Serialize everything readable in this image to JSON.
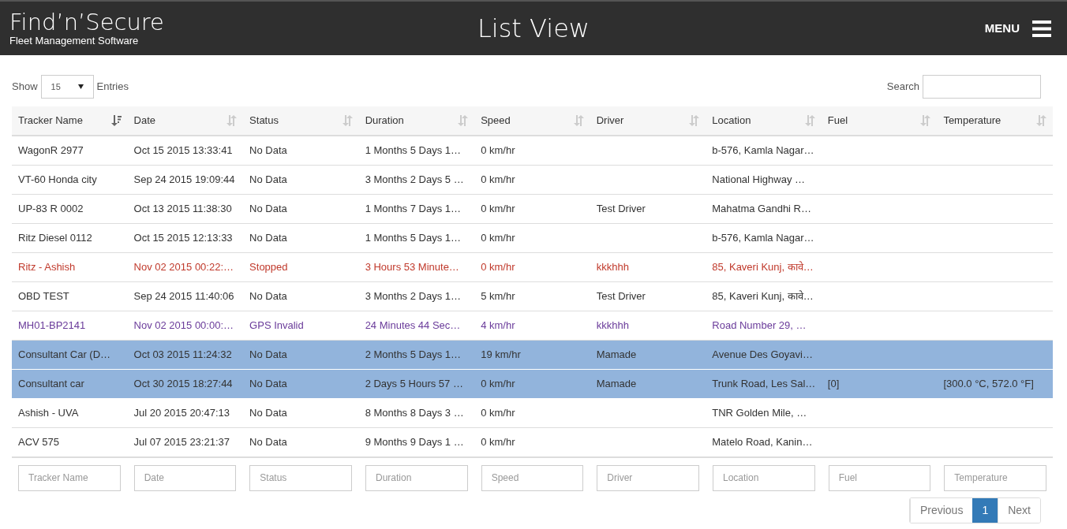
{
  "header": {
    "logo": "Find’n’Secure",
    "tagline": "Fleet Management Software",
    "title": "List View",
    "menu": "MENU"
  },
  "length": {
    "show": "Show",
    "value": "15",
    "entries": "Entries"
  },
  "search": {
    "label": "Search"
  },
  "table": {
    "columns": [
      {
        "label": "Tracker Name",
        "sorted": true
      },
      {
        "label": "Date",
        "sorted": false
      },
      {
        "label": "Status",
        "sorted": false
      },
      {
        "label": "Duration",
        "sorted": false
      },
      {
        "label": "Speed",
        "sorted": false
      },
      {
        "label": "Driver",
        "sorted": false
      },
      {
        "label": "Location",
        "sorted": false
      },
      {
        "label": "Fuel",
        "sorted": false
      },
      {
        "label": "Temperature",
        "sorted": false
      }
    ],
    "rows": [
      {
        "kind": "normal",
        "selected": false,
        "cells": [
          "WagonR 2977",
          "Oct 15 2015 13:33:41",
          "No Data",
          "1 Months 5 Days 1…",
          "0 km/hr",
          "",
          "b-576, Kamla Nagar…",
          "",
          ""
        ]
      },
      {
        "kind": "normal",
        "selected": false,
        "cells": [
          "VT-60 Honda city",
          "Sep 24 2015 19:09:44",
          "No Data",
          "3 Months 2 Days 5 …",
          "0 km/hr",
          "",
          "National Highway …",
          "",
          ""
        ]
      },
      {
        "kind": "normal",
        "selected": false,
        "cells": [
          "UP-83 R 0002",
          "Oct 13 2015 11:38:30",
          "No Data",
          "1 Months 7 Days 1…",
          "0 km/hr",
          "Test Driver",
          "Mahatma Gandhi R…",
          "",
          ""
        ]
      },
      {
        "kind": "normal",
        "selected": false,
        "cells": [
          "Ritz Diesel 0112",
          "Oct 15 2015 12:13:33",
          "No Data",
          "1 Months 5 Days 1…",
          "0 km/hr",
          "",
          "b-576, Kamla Nagar…",
          "",
          ""
        ]
      },
      {
        "kind": "stopped",
        "selected": false,
        "cells": [
          "Ritz - Ashish",
          "Nov 02 2015 00:22:…",
          "Stopped",
          "3 Hours 53 Minute…",
          "0 km/hr",
          "kkkhhh",
          "85, Kaveri Kunj, कावे…",
          "",
          ""
        ]
      },
      {
        "kind": "normal",
        "selected": false,
        "cells": [
          "OBD TEST",
          "Sep 24 2015 11:40:06",
          "No Data",
          "3 Months 2 Days 1…",
          "5 km/hr",
          "Test Driver",
          "85, Kaveri Kunj, कावे…",
          "",
          ""
        ]
      },
      {
        "kind": "gps-invalid",
        "selected": false,
        "cells": [
          "MH01-BP2141",
          "Nov 02 2015 00:00:…",
          "GPS Invalid",
          "24 Minutes 44 Sec…",
          "4 km/hr",
          "kkkhhh",
          "Road Number 29, …",
          "",
          ""
        ]
      },
      {
        "kind": "normal",
        "selected": true,
        "cells": [
          "Consultant Car (D…",
          "Oct 03 2015 11:24:32",
          "No Data",
          "2 Months 5 Days 1…",
          "19 km/hr",
          "Mamade",
          "Avenue Des Goyavi…",
          "",
          ""
        ]
      },
      {
        "kind": "normal",
        "selected": true,
        "cells": [
          "Consultant car",
          "Oct 30 2015 18:27:44",
          "No Data",
          "2 Days 5 Hours 57 …",
          "0 km/hr",
          "Mamade",
          "Trunk Road, Les Sal…",
          "[0]",
          "[300.0 °C, 572.0 °F]"
        ]
      },
      {
        "kind": "normal",
        "selected": false,
        "cells": [
          "Ashish - UVA",
          "Jul 20 2015 20:47:13",
          "No Data",
          "8 Months 8 Days 3 …",
          "0 km/hr",
          "",
          "TNR Golden Mile, …",
          "",
          ""
        ]
      },
      {
        "kind": "normal",
        "selected": false,
        "cells": [
          "ACV 575",
          "Jul 07 2015 23:21:37",
          "No Data",
          "9 Months 9 Days 1 …",
          "0 km/hr",
          "",
          "Matelo Road, Kanin…",
          "",
          ""
        ]
      }
    ],
    "filters": [
      {
        "placeholder": "Tracker Name"
      },
      {
        "placeholder": "Date"
      },
      {
        "placeholder": "Status"
      },
      {
        "placeholder": "Duration"
      },
      {
        "placeholder": "Speed"
      },
      {
        "placeholder": "Driver"
      },
      {
        "placeholder": "Location"
      },
      {
        "placeholder": "Fuel"
      },
      {
        "placeholder": "Temperature"
      }
    ]
  },
  "pagination": [
    {
      "label": "Previous",
      "selected": false
    },
    {
      "label": "1",
      "selected": true
    },
    {
      "label": "Next",
      "selected": false
    }
  ]
}
